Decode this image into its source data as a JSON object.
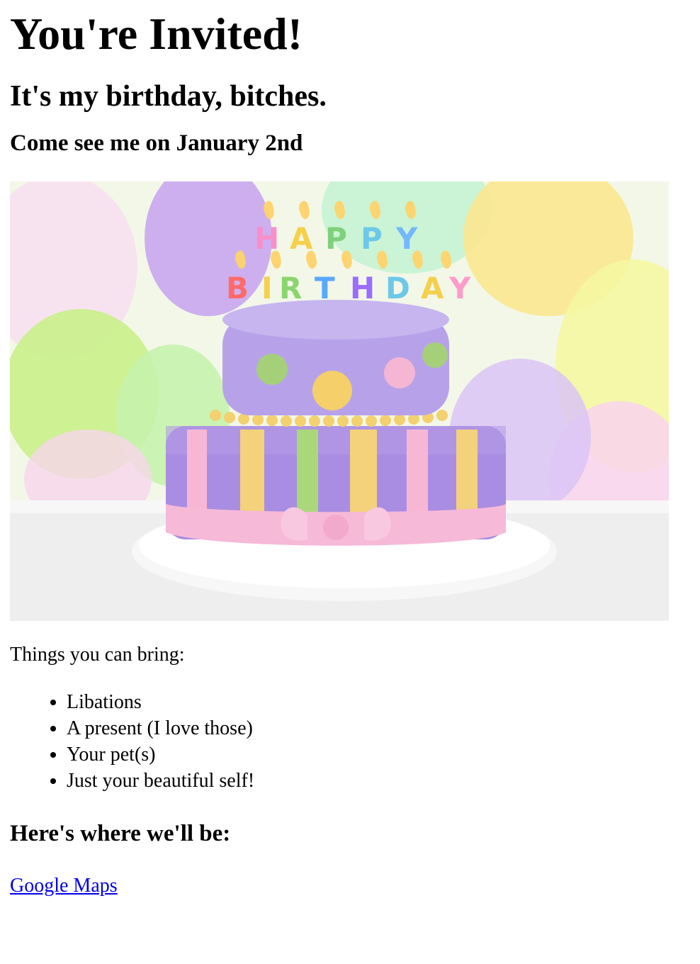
{
  "title": "You're Invited!",
  "subtitle": "It's my birthday, bitches.",
  "date_line": "Come see me on January 2nd",
  "hero_image": {
    "icon": "birthday-cake-image"
  },
  "bring_intro": "Things you can bring:",
  "bring_items": [
    "Libations",
    "A present (I love those)",
    "Your pet(s)",
    "Just your beautiful self!"
  ],
  "where_heading": "Here's where we'll be:",
  "maps_link": {
    "label": "Google Maps"
  },
  "colors": {
    "link": "#0000ee",
    "text": "#000000",
    "background": "#ffffff"
  }
}
